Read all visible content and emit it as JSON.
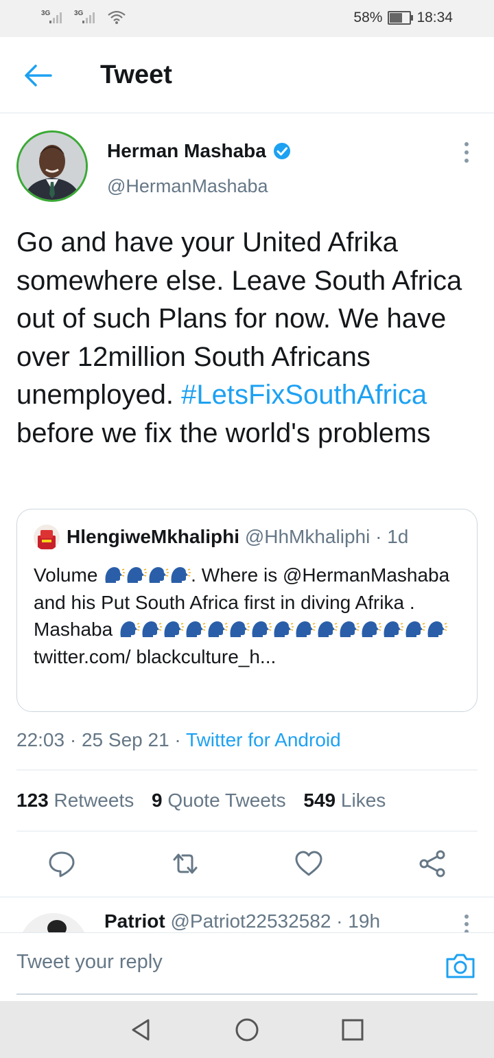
{
  "status_bar": {
    "network_1": "3G",
    "network_2": "3G",
    "battery_percent": "58%",
    "battery_level": 0.58,
    "time": "18:34"
  },
  "header": {
    "title": "Tweet",
    "back_icon": "arrow-left-icon"
  },
  "tweet": {
    "author_name": "Herman Mashaba",
    "author_handle": "@HermanMashaba",
    "verified": true,
    "text_before": "Go and have your United Afrika somewhere else. Leave South Africa out of such Plans for now. We have over 12million South Africans unemployed. ",
    "hashtag": "#LetsFixSouthAfrica",
    "text_after": " before we fix the world's problems",
    "quote": {
      "author_name": "HlengiweMkhaliphi",
      "author_handle": "@HhMkhaliphi",
      "separator": " · ",
      "age": "1d",
      "text_1": "Volume ",
      "text_2": ". Where is @HermanMashaba and his Put South Africa first in diving Afrika . Mashaba ",
      "text_3": " twitter.com/ blackculture_h...",
      "emoji": "speaking-head-emoji"
    },
    "time": "22:03",
    "date": "25 Sep 21",
    "dot": " · ",
    "source": "Twitter for Android",
    "stats": {
      "retweets_count": "123",
      "retweets_label": "Retweets",
      "quotes_count": "9",
      "quotes_label": "Quote Tweets",
      "likes_count": "549",
      "likes_label": "Likes"
    },
    "actions": [
      "reply-icon",
      "retweet-icon",
      "like-icon",
      "share-icon"
    ]
  },
  "reply_preview": {
    "author_name": "Patriot",
    "author_handle": "@Patriot22532582",
    "separator": " · ",
    "age": "19h"
  },
  "composer": {
    "placeholder": "Tweet your reply",
    "camera_icon": "camera-icon"
  },
  "navbar": [
    "back-triangle-icon",
    "home-circle-icon",
    "recents-square-icon"
  ],
  "colors": {
    "accent": "#1da1f2",
    "secondary_text": "#657786",
    "avatar_ring": "#3aa935"
  }
}
